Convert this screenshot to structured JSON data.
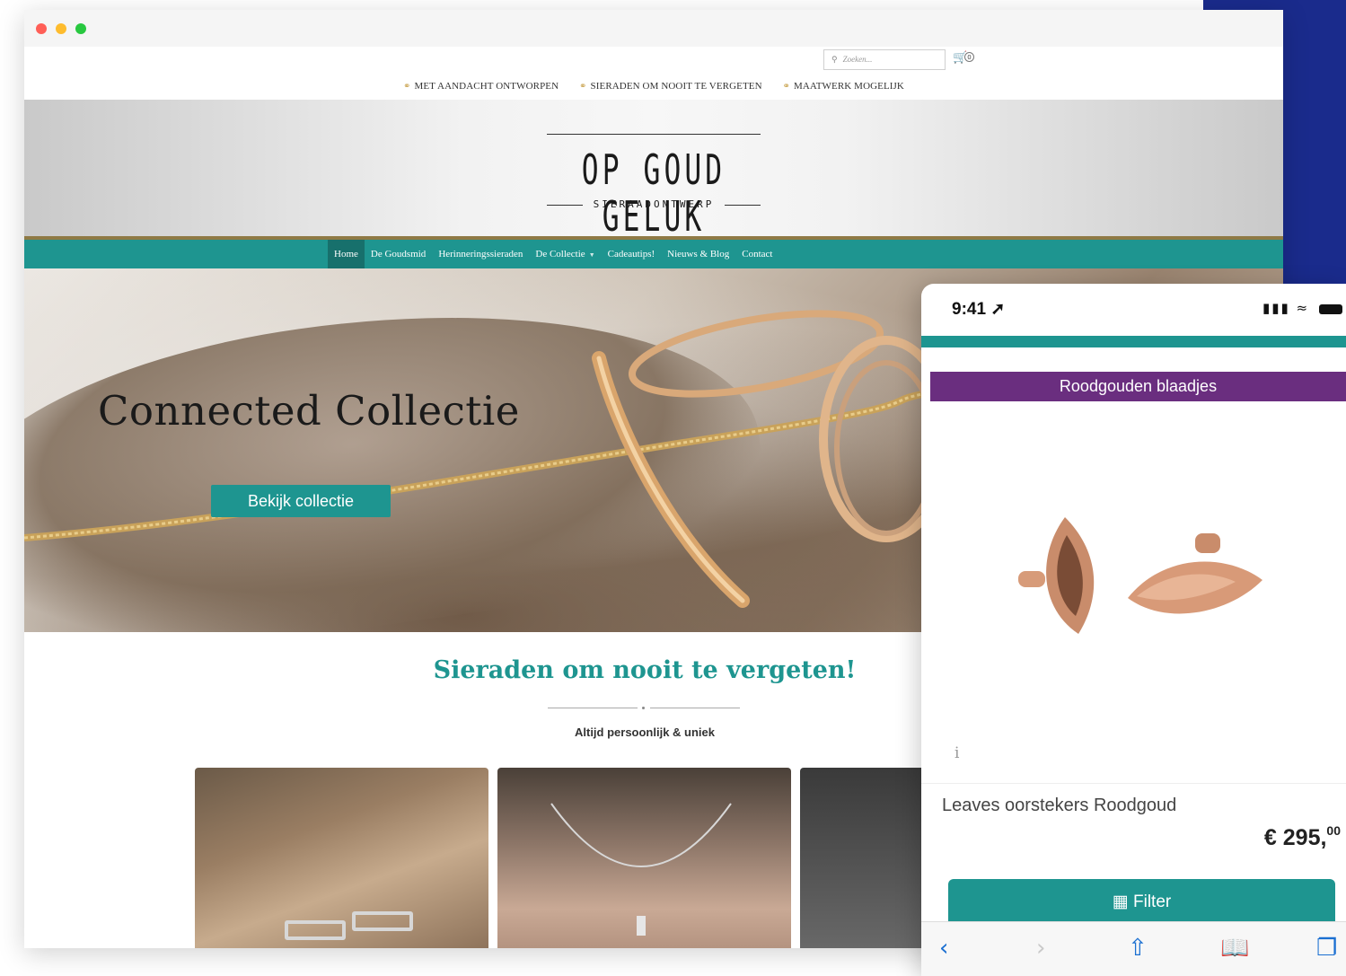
{
  "browser": {
    "search_placeholder": "Zoeken...",
    "cart_count": "0",
    "usps": [
      "MET AANDACHT ONTWORPEN",
      "SIERADEN OM NOOIT TE VERGETEN",
      "MAATWERK MOGELIJK"
    ],
    "logo": {
      "main": "OP GOUD GELUK",
      "sub": "SIERAADONTWERP"
    },
    "nav": [
      {
        "label": "Home",
        "active": true
      },
      {
        "label": "De Goudsmid"
      },
      {
        "label": "Herinneringssieraden"
      },
      {
        "label": "De Collectie",
        "has_caret": true
      },
      {
        "label": "Cadeautips!"
      },
      {
        "label": "Nieuws & Blog"
      },
      {
        "label": "Contact"
      }
    ],
    "hero": {
      "title": "Connected Collectie",
      "button": "Bekijk collectie"
    },
    "tagline": {
      "title": "Sieraden om nooit te vergeten!",
      "subtitle": "Altijd persoonlijk & uniek"
    }
  },
  "phone": {
    "time": "9:41",
    "category": "Roodgouden blaadjes",
    "product_name": "Leaves oorstekers Roodgoud",
    "price_main": "€ 295,",
    "price_cents": "00",
    "filter_label": "Filter"
  },
  "colors": {
    "teal": "#1e9590",
    "purple": "#6a2e7f",
    "navy": "#1a2b8c",
    "gold": "#8f7a45"
  }
}
